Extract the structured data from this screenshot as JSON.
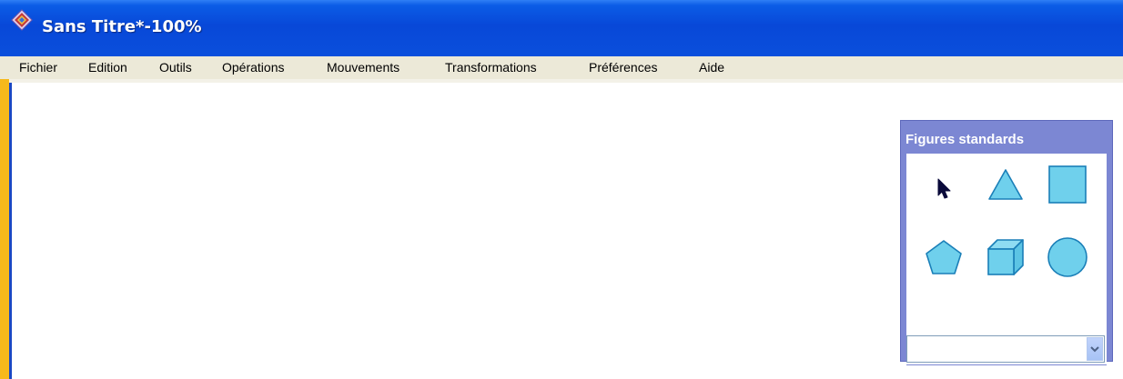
{
  "window": {
    "title": "Sans Titre*-100%",
    "icon": "app-diamond-icon"
  },
  "menubar": {
    "items": [
      "Fichier",
      "Edition",
      "Outils",
      "Opérations",
      "Mouvements",
      "Transformations",
      "Préférences",
      "Aide"
    ]
  },
  "palette": {
    "title": "Figures standards",
    "tools": [
      {
        "name": "arrow-pointer-icon"
      },
      {
        "name": "triangle-icon"
      },
      {
        "name": "square-icon"
      },
      {
        "name": "pentagon-icon"
      },
      {
        "name": "cube-icon"
      },
      {
        "name": "circle-icon"
      }
    ],
    "dropdown": {
      "value": "",
      "icon": "chevron-down-icon"
    }
  },
  "colors": {
    "title_bar": "#0a4fdc",
    "frame": "#f7b91b",
    "palette_frame": "#7c87d3",
    "shape_fill": "#6fd0ec",
    "shape_stroke": "#1a7fb8"
  }
}
